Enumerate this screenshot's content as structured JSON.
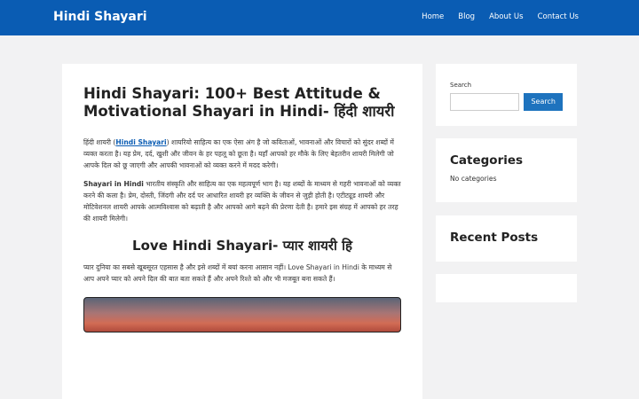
{
  "header": {
    "site_title": "Hindi Shayari",
    "nav": [
      "Home",
      "Blog",
      "About Us",
      "Contact Us"
    ]
  },
  "article": {
    "title": "Hindi Shayari: 100+ Best Attitude & Motivational Shayari in Hindi- हिंदी शायरी",
    "p1_before": "हिंदी शायरी (",
    "p1_link": "Hindi Shayari",
    "p1_after": ") शायरियो साहित्य का एक ऐसा अंग है जो कविताओं, भावनाओं और विचारों को सुंदर शब्दों में व्यक्त करता है। यह प्रेम, दर्द, खुशी और जीवन के हर पहलू को छूता है। यहाँ आपको हर मौके के लिए बेहतरीन शायरी मिलेगी जो आपके दिल को छू जाएगी और आपकी भावनाओं को व्यक्त करने में मदद करेगी।",
    "p2_bold": "Shayari in Hindi",
    "p2_text": " भारतीय संस्कृति और साहित्य का एक महत्वपूर्ण भाग है। यह शब्दों के माध्यम से गहरी भावनाओं को व्यक्त करने की कला है। प्रेम, दोस्ती, जिंदगी और दर्द पर आधारित शायरी हर व्यक्ति के जीवन से जुड़ी होती है। एटीट्यूड शायरी और मोटिवेशनल शायरी आपके आत्मविश्वास को बढ़ाती है और आपको आगे बढ़ने की प्रेरणा देती है। हमारे इस संग्रह में आपको हर तरह की शायरी मिलेगी।",
    "h2": "Love Hindi Shayari- प्यार शायरी हि",
    "p3": "प्यार दुनिया का सबसे खूबसूरत एहसास है और इसे शब्दों में बयां करना आसान नहीं। Love Shayari in Hindi के माध्यम से आप अपने प्यार को अपने दिल की बात बता सकते हैं और अपने रिश्ते को और भी मजबूत बना सकते हैं।"
  },
  "sidebar": {
    "search_label": "Search",
    "search_value": "",
    "search_button": "Search",
    "categories_title": "Categories",
    "categories_empty": "No categories",
    "recent_title": "Recent Posts"
  },
  "colors": {
    "header_bg": "#0a5cb3",
    "button_bg": "#1e73be",
    "link": "#0a5cb3",
    "page_bg": "#f2f2f3"
  }
}
